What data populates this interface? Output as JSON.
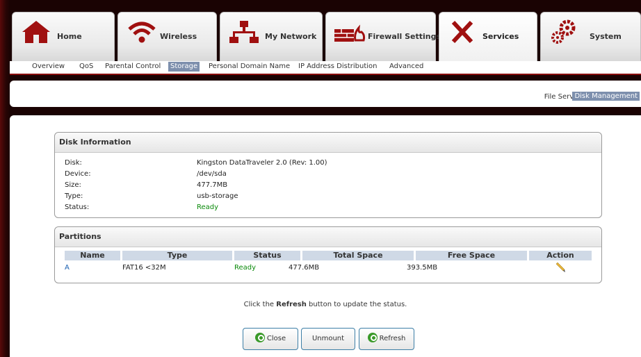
{
  "nav": {
    "tabs": [
      {
        "label": "Home",
        "icon": "home-icon"
      },
      {
        "label": "Wireless",
        "icon": "wifi-icon"
      },
      {
        "label": "My Network",
        "icon": "network-icon"
      },
      {
        "label": "Firewall Settings",
        "icon": "firewall-icon"
      },
      {
        "label": "Services",
        "icon": "tools-icon",
        "active": true
      },
      {
        "label": "System",
        "icon": "gears-icon"
      }
    ],
    "subtabs": [
      "Overview",
      "QoS",
      "Parental Control",
      "Storage",
      "Personal Domain Name",
      "IP Address Distribution",
      "Advanced"
    ],
    "active_subtab": "Storage"
  },
  "storage_nav": {
    "file_server": "File Server",
    "separator": "|",
    "disk_management": "Disk Management"
  },
  "disk_info": {
    "title": "Disk Information",
    "rows": [
      {
        "label": "Disk:",
        "value": "Kingston DataTraveler 2.0 (Rev: 1.00)"
      },
      {
        "label": "Device:",
        "value": "/dev/sda"
      },
      {
        "label": "Size:",
        "value": "477.7MB"
      },
      {
        "label": "Type:",
        "value": "usb-storage"
      },
      {
        "label": "Status:",
        "value": "Ready"
      }
    ]
  },
  "partitions": {
    "title": "Partitions",
    "columns": [
      "Name",
      "Type",
      "Status",
      "Total Space",
      "Free Space",
      "Action"
    ],
    "rows": [
      {
        "name": "A",
        "type": "FAT16 <32M",
        "status": "Ready",
        "total": "477.6MB",
        "free": "393.5MB",
        "action_icon": "edit-pencil-icon"
      }
    ]
  },
  "hint": {
    "prefix": "Click the ",
    "bold": "Refresh",
    "suffix": " button to update the status."
  },
  "buttons": {
    "close": "Close",
    "unmount": "Unmount",
    "refresh": "Refresh"
  },
  "colors": {
    "accent_red": "#8a0d0d",
    "active_highlight": "#7d8fad",
    "ready_green": "#0a8a0a",
    "table_header": "#cfd9e6"
  }
}
